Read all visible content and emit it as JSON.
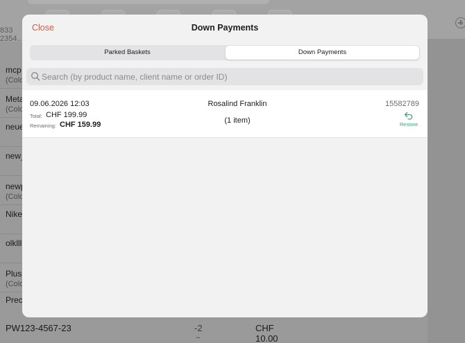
{
  "background": {
    "left_number": "2354..",
    "left_code": "833",
    "list": [
      {
        "name": "mcp",
        "sub": "(Colo"
      },
      {
        "name": "Meta",
        "sub": "(Colo"
      },
      {
        "name": "neue",
        "sub": ""
      },
      {
        "name": "new_",
        "sub": ""
      },
      {
        "name": "newp",
        "sub": "(Colo"
      },
      {
        "name": "Nike",
        "sub": ""
      },
      {
        "name": "olklll",
        "sub": ""
      },
      {
        "name": "Plush",
        "sub": "(Colo"
      },
      {
        "name": "Prec",
        "sub": ""
      }
    ],
    "bottom_row": {
      "code": "PW123-4567-23",
      "qty": "-2",
      "price": "CHF 10.00"
    }
  },
  "modal": {
    "close_label": "Close",
    "title": "Down Payments",
    "tabs": [
      {
        "label": "Parked Baskets",
        "selected": false
      },
      {
        "label": "Down Payments",
        "selected": true
      }
    ],
    "search": {
      "placeholder": "Search (by product name, client name or order ID)",
      "value": ""
    },
    "rows": [
      {
        "date": "09.06.2026 12:03",
        "total_label": "Total:",
        "total": "CHF 199.99",
        "remaining_label": "Remaining:",
        "remaining": "CHF 159.99",
        "client": "Rosalind Franklin",
        "items": "(1 item)",
        "order_id": "15582789",
        "action": "Restore",
        "action_icon": "restore-arrow-icon"
      }
    ]
  },
  "colors": {
    "accent_close": "#e0563f",
    "accent_restore": "#3aa37a"
  }
}
